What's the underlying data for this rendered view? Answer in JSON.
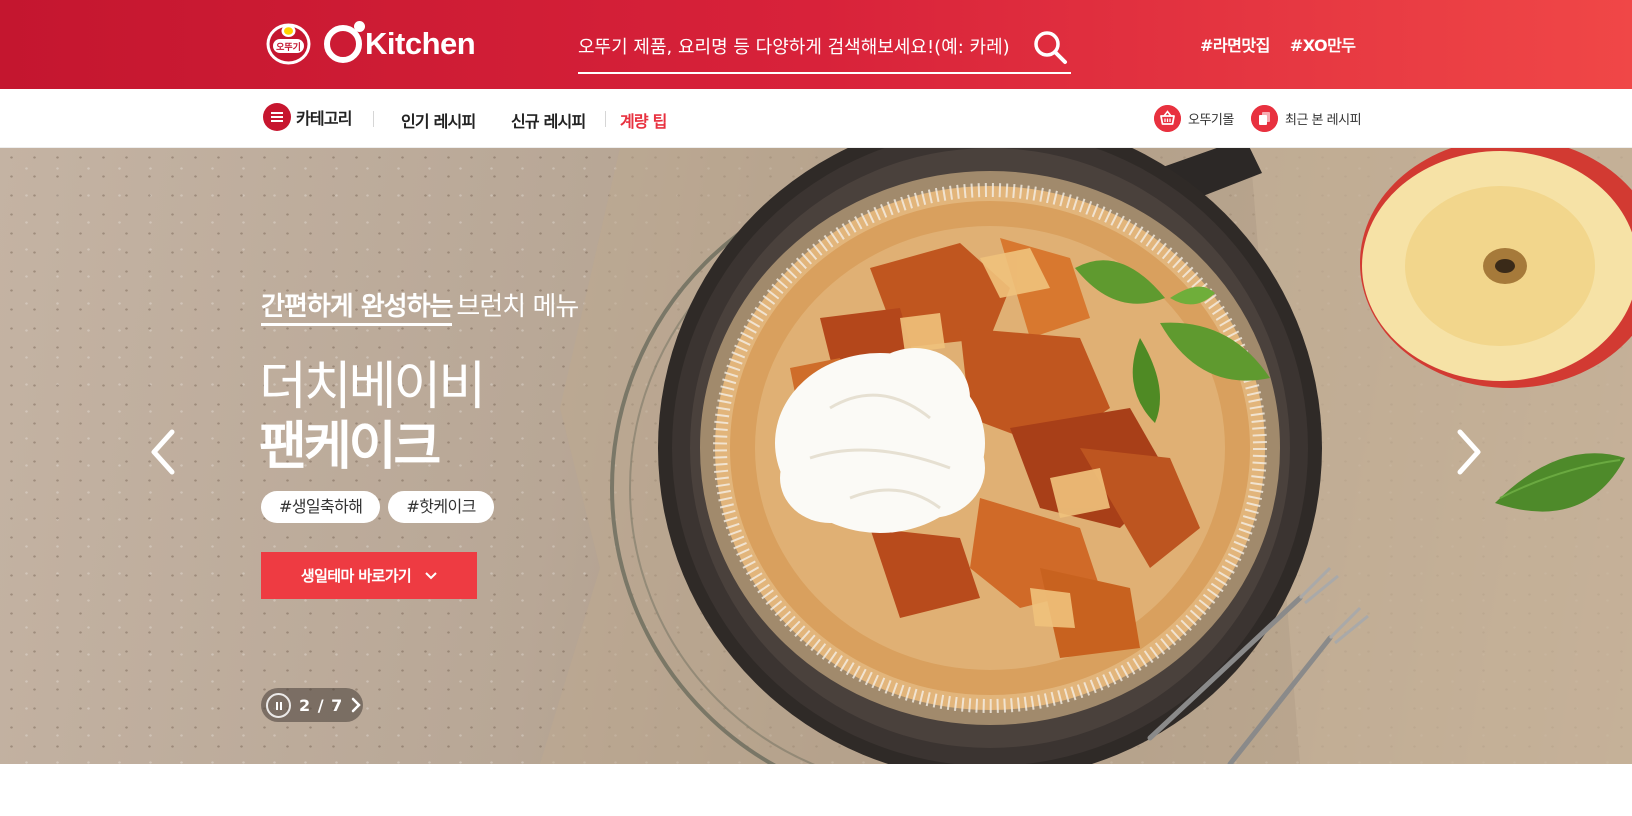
{
  "header": {
    "brand_name": "Kitchen",
    "ottogi_logo_text": "오뚜기",
    "search": {
      "placeholder": "오뚜기 제품, 요리명 등 다양하게 검색해보세요!(예: 카레)",
      "value": ""
    },
    "trending_tags": [
      "#라면맛집",
      "#XO만두"
    ]
  },
  "nav": {
    "category_label": "카테고리",
    "links": [
      "인기 레시피",
      "신규 레시피",
      "계량 팁"
    ],
    "utilities": [
      "오뚜기몰",
      "최근 본 레시피"
    ]
  },
  "hero": {
    "eyebrow_strong": "간편하게 완성하는",
    "eyebrow_rest": "브런치 메뉴",
    "title_line1": "더치베이비",
    "title_line2": "팬케이크",
    "hashtags": [
      "#생일축하해",
      "#핫케이크"
    ],
    "cta_label": "생일테마 바로가기",
    "pager": {
      "current": 2,
      "total": 7,
      "text": "2 / 7"
    }
  },
  "colors": {
    "header_red": "#c4162f",
    "accent_red": "#e8313f",
    "cta_red": "#ee3b42"
  },
  "icons": [
    "ottogi-logo",
    "search-icon",
    "menu-icon",
    "basket-icon",
    "recent-icon",
    "chevron-left-icon",
    "chevron-right-icon",
    "pause-icon",
    "chevron-down-icon"
  ]
}
